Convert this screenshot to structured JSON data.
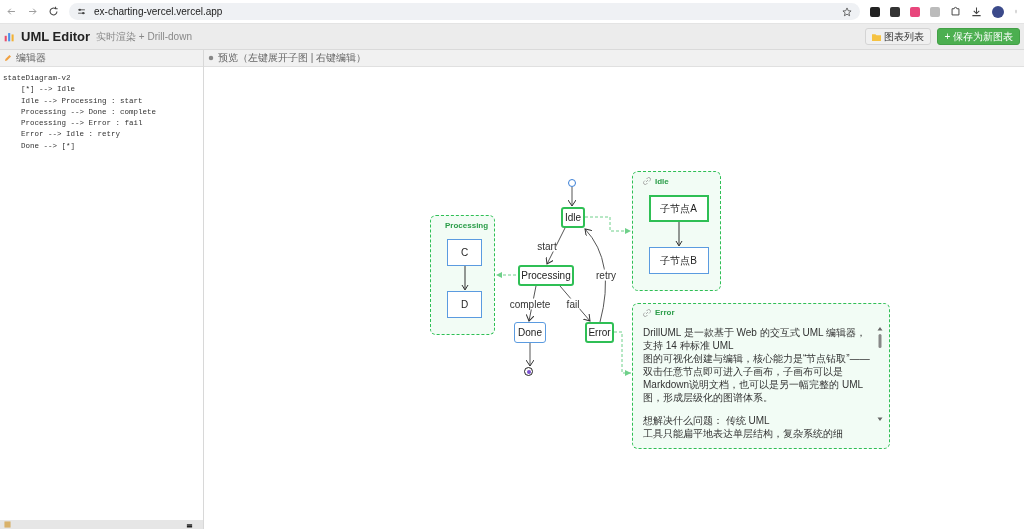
{
  "browser": {
    "url": "ex-charting-vercel.vercel.app"
  },
  "header": {
    "title": "UML Editor",
    "subtitle": "实时渲染 + Drill-down",
    "buttons": [
      {
        "label": "图表列表",
        "kind": "secondary"
      },
      {
        "label": "+ 保存为新图表",
        "kind": "primary"
      }
    ]
  },
  "editor": {
    "title": "编辑器",
    "lines": [
      "stateDiagram-v2",
      "    [*] --> Idle",
      "    Idle --> Processing : start",
      "    Processing --> Done : complete",
      "    Processing --> Error : fail",
      "    Error --> Idle : retry",
      "    Done --> [*]"
    ]
  },
  "preview": {
    "title": "预览（左键展开子图 | 右键编辑）",
    "diagram": {
      "nodes": [
        {
          "kind": "start"
        },
        {
          "kind": "state",
          "label": "Idle",
          "has_subchart": true
        },
        {
          "kind": "state",
          "label": "Processing",
          "has_subchart": true
        },
        {
          "kind": "state",
          "label": "Done",
          "has_subchart": false
        },
        {
          "kind": "state",
          "label": "Error",
          "has_subchart": true
        },
        {
          "kind": "end"
        }
      ],
      "edges": [
        {
          "kind": "plain"
        },
        {
          "kind": "labeled",
          "label": "start"
        },
        {
          "kind": "labeled",
          "label": "complete"
        },
        {
          "kind": "labeled",
          "label": "fail"
        },
        {
          "kind": "labeled",
          "label": "retry"
        },
        {
          "kind": "plain"
        }
      ],
      "subcharts": [
        {
          "kind": "diagram",
          "title": "Processing",
          "nodes": [
            {
              "label": "C",
              "has_subchart": false
            },
            {
              "label": "D",
              "has_subchart": false
            }
          ]
        },
        {
          "kind": "diagram",
          "title": "Idle",
          "nodes": [
            {
              "label": "子节点A",
              "has_subchart": true
            },
            {
              "label": "子节点B",
              "has_subchart": false
            }
          ]
        },
        {
          "kind": "document",
          "title": "Error",
          "paragraphs": [
            [
              "DrillUML 是一款基于 Web 的交互式 UML 编辑器，支持 14 种标准 UML",
              "图的可视化创建与编辑，核心能力是“节点钻取”——双击任意节点即可进入子画布，子画布可以是 Markdown说明文档，也可以是另一幅完整的 UML 图，形成层级化的图谱体系。"
            ],
            [
              "想解决什么问题： 传统 UML",
              "工具只能扁平地表达单层结构，复杂系统的细"
            ]
          ]
        }
      ]
    }
  }
}
